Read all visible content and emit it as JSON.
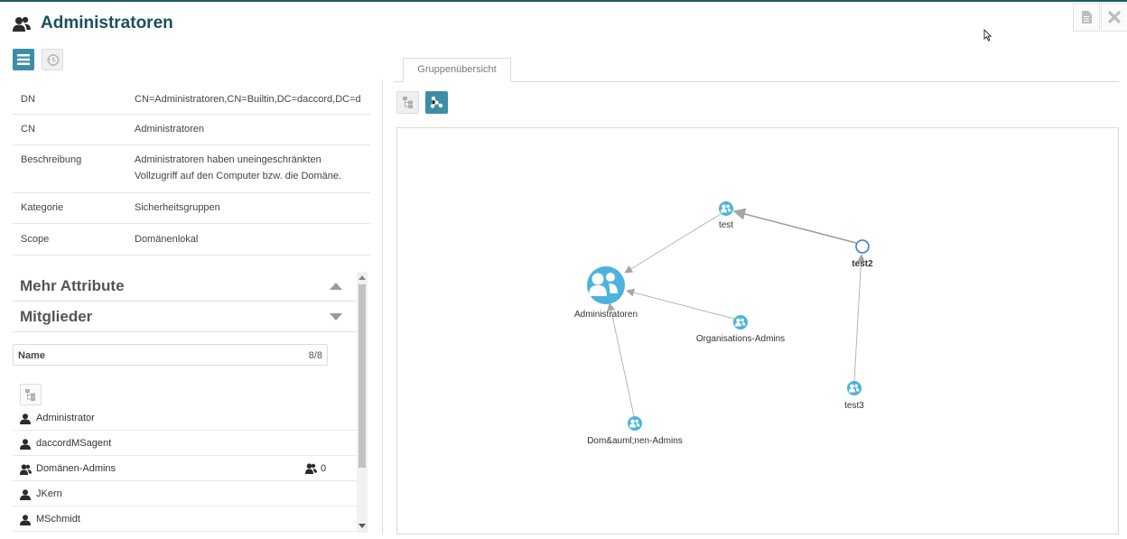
{
  "header": {
    "title": "Administratoren",
    "title_icon": "group-icon",
    "actions": [
      {
        "icon": "document-icon"
      },
      {
        "icon": "close-icon"
      }
    ]
  },
  "view_toggle": {
    "list_icon": "list-icon",
    "history_icon": "history-icon"
  },
  "attributes": [
    {
      "key": "DN",
      "value": "CN=Administratoren,CN=Builtin,DC=daccord,DC=d"
    },
    {
      "key": "CN",
      "value": "Administratoren"
    },
    {
      "key": "Beschreibung",
      "value": "Administratoren haben uneingeschränkten Vollzugriff auf den Computer bzw. die Domäne."
    },
    {
      "key": "Kategorie",
      "value": "Sicherheitsgruppen"
    },
    {
      "key": "Scope",
      "value": "Domänenlokal"
    }
  ],
  "sections": {
    "more_attributes": "Mehr Attribute",
    "members": "Mitglieder"
  },
  "members_table": {
    "name_header": "Name",
    "count": "8/8",
    "rows": [
      {
        "name": "Administrator",
        "type": "user"
      },
      {
        "name": "daccordMSagent",
        "type": "user"
      },
      {
        "name": "Domänen-Admins",
        "type": "group",
        "member_count": "0"
      },
      {
        "name": "JKern",
        "type": "user"
      },
      {
        "name": "MSchmidt",
        "type": "user"
      }
    ]
  },
  "right_panel": {
    "tab_label": "Gruppenübersicht",
    "view_buttons": [
      "tree-view",
      "graph-view"
    ]
  },
  "graph": {
    "nodes": [
      {
        "id": "admin",
        "label": "Administratoren",
        "bold": false
      },
      {
        "id": "test",
        "label": "test",
        "bold": false
      },
      {
        "id": "test2",
        "label": "test2",
        "bold": true
      },
      {
        "id": "orga",
        "label": "Organisations-Admins",
        "bold": false
      },
      {
        "id": "test3",
        "label": "test3",
        "bold": false
      },
      {
        "id": "dom",
        "label": "Dom&auml;nen-Admins",
        "bold": false
      }
    ],
    "edges": [
      {
        "from": "test",
        "to": "admin"
      },
      {
        "from": "test2",
        "to": "test"
      },
      {
        "from": "orga",
        "to": "admin"
      },
      {
        "from": "dom",
        "to": "admin"
      },
      {
        "from": "test3",
        "to": "test2"
      }
    ]
  },
  "colors": {
    "accent": "#3d8ea5",
    "title": "#1b4f5d",
    "node": "#4bb3dc"
  }
}
